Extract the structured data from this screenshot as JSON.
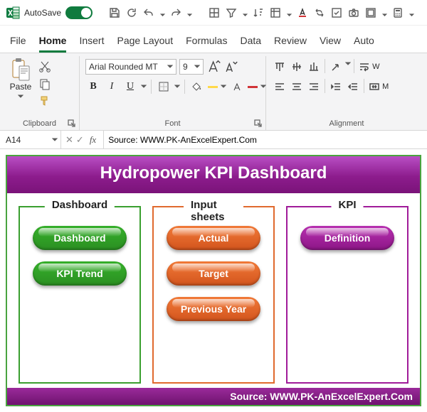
{
  "qat": {
    "autosave_label": "AutoSave",
    "autosave_on": true
  },
  "tabs": {
    "file": "File",
    "home": "Home",
    "insert": "Insert",
    "page_layout": "Page Layout",
    "formulas": "Formulas",
    "data": "Data",
    "review": "Review",
    "view": "View",
    "automate": "Auto"
  },
  "ribbon": {
    "clipboard": {
      "caption": "Clipboard",
      "paste": "Paste"
    },
    "font": {
      "caption": "Font",
      "name": "Arial Rounded MT",
      "size": "9",
      "bold": "B",
      "italic": "I",
      "underline": "U"
    },
    "alignment": {
      "caption": "Alignment",
      "wrap": "W",
      "merge": "M"
    }
  },
  "fx": {
    "namebox": "A14",
    "formula": "Source: WWW.PK-AnExcelExpert.Com"
  },
  "dashboard": {
    "title": "Hydropower KPI Dashboard",
    "groups": [
      {
        "legend": "Dashboard",
        "color": "green",
        "pills": [
          "Dashboard",
          "KPI Trend"
        ]
      },
      {
        "legend": "Input sheets",
        "color": "orange",
        "pills": [
          "Actual",
          "Target",
          "Previous Year"
        ]
      },
      {
        "legend": "KPI",
        "color": "magenta",
        "pills": [
          "Definition"
        ]
      }
    ],
    "footer": "Source: WWW.PK-AnExcelExpert.Com"
  }
}
